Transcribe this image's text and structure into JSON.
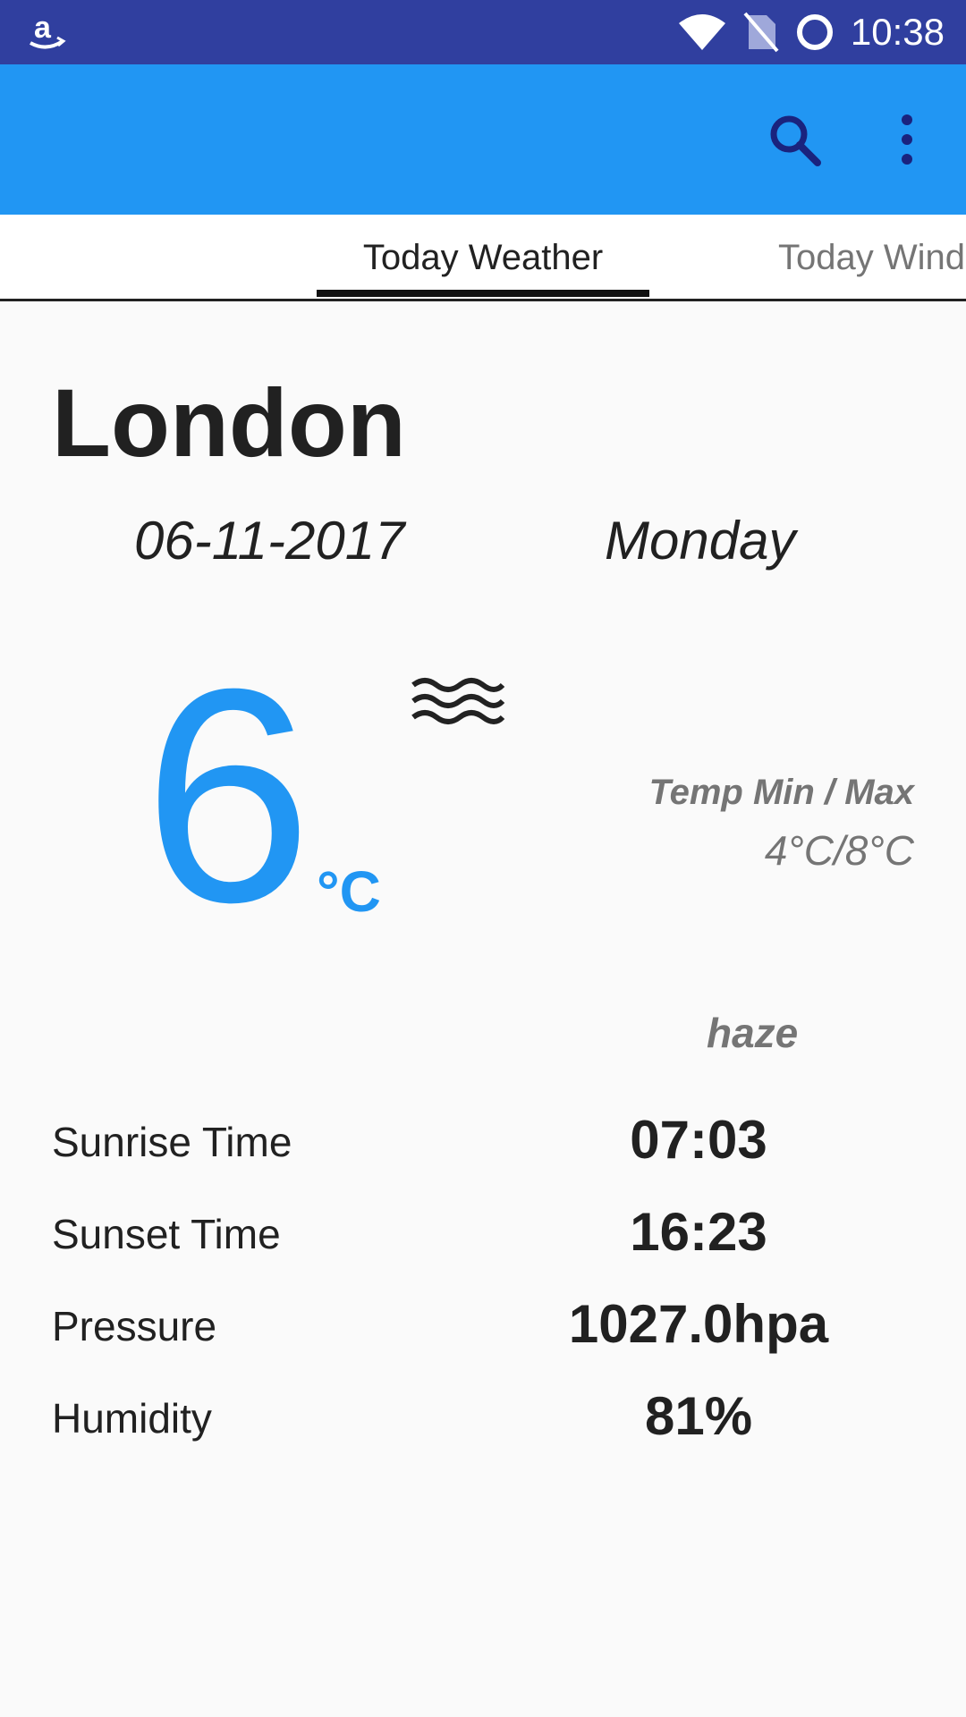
{
  "status_bar": {
    "time": "10:38",
    "icons": [
      "amazon-icon",
      "wifi-icon",
      "no-sim-icon",
      "sync-circle-icon"
    ]
  },
  "app_bar": {
    "color": "#2196f3",
    "icons": [
      "search-icon",
      "overflow-menu-icon"
    ]
  },
  "tabs": [
    {
      "label": "Today Weather",
      "selected": true
    },
    {
      "label": "Today Wind",
      "selected": false
    }
  ],
  "weather": {
    "city": "London",
    "date": "06-11-2017",
    "weekday": "Monday",
    "temperature": "6",
    "unit": "°C",
    "icon": "haze-icon",
    "minmax_label": "Temp Min / Max",
    "minmax_value": "4°C/8°C",
    "condition": "haze"
  },
  "details": [
    {
      "label": "Sunrise Time",
      "value": "07:03"
    },
    {
      "label": "Sunset Time",
      "value": "16:23"
    },
    {
      "label": "Pressure",
      "value": "1027.0hpa"
    },
    {
      "label": "Humidity",
      "value": "81%"
    }
  ],
  "colors": {
    "status_bar": "#303f9f",
    "accent": "#2196f3",
    "secondary_text": "#757575"
  }
}
